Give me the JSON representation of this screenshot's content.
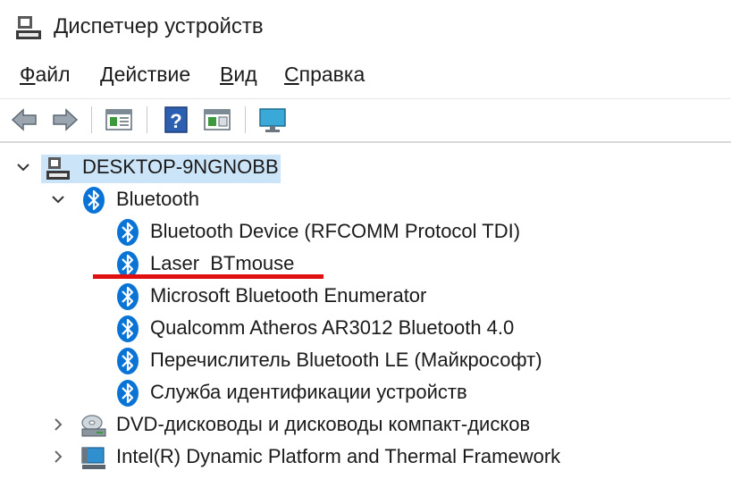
{
  "window": {
    "title": "Диспетчер устройств"
  },
  "menu": [
    {
      "label_ul": "Ф",
      "label_rest": "айл"
    },
    {
      "label_ul": "Д",
      "label_rest": "ействие"
    },
    {
      "label_ul": "В",
      "label_rest": "ид"
    },
    {
      "label_ul": "С",
      "label_rest": "правка"
    }
  ],
  "toolbar": {
    "buttons": [
      "back-icon",
      "forward-icon",
      "properties-icon",
      "help-icon",
      "show-hide-icon",
      "monitor-icon"
    ]
  },
  "tree": {
    "root": {
      "label": "DESKTOP-9NGNOBB",
      "icon": "computer-icon",
      "expanded": true
    },
    "bluetooth": {
      "label": "Bluetooth",
      "icon": "bluetooth-icon",
      "expanded": true
    },
    "bluetooth_devices": [
      {
        "label": "Bluetooth Device (RFCOMM Protocol TDI)"
      },
      {
        "label": "Laser  BTmouse"
      },
      {
        "label": "Microsoft Bluetooth Enumerator"
      },
      {
        "label": "Qualcomm Atheros AR3012 Bluetooth 4.0"
      },
      {
        "label": "Перечислитель Bluetooth LE (Майкрософт)"
      },
      {
        "label": "Служба идентификации устройств"
      }
    ],
    "dvd": {
      "label": "DVD-дисководы и дисководы компакт-дисков",
      "icon": "dvd-drive-icon",
      "expanded": false
    },
    "intel": {
      "label": "Intel(R) Dynamic Platform and Thermal Framework",
      "icon": "system-device-icon",
      "expanded": false
    }
  },
  "colors": {
    "selection": "#cce4f7",
    "bluetooth": "#0a74d6",
    "annotation": "#e01010"
  }
}
